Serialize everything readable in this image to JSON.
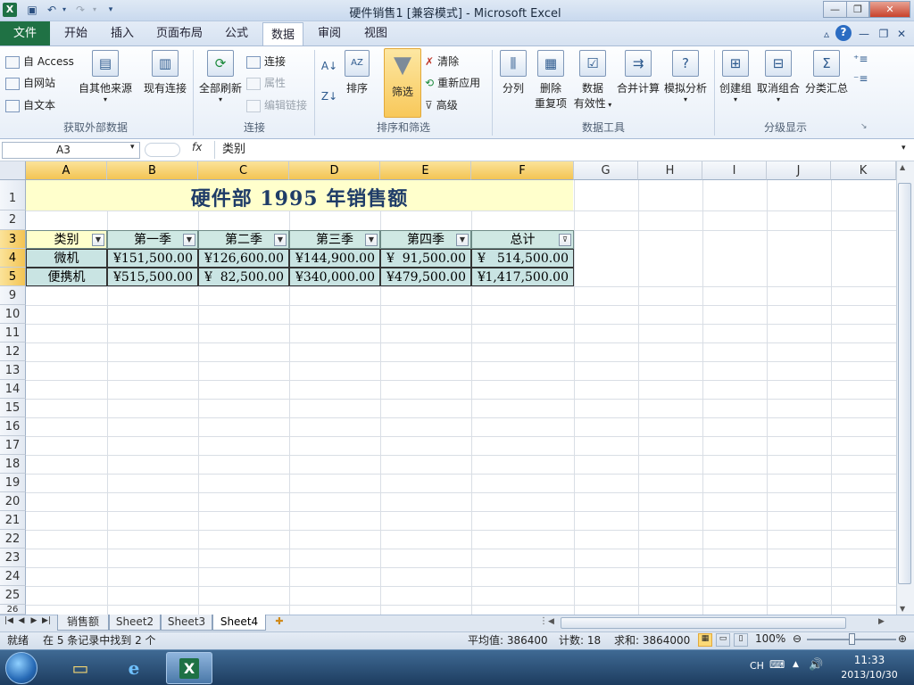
{
  "window": {
    "title": "硬件销售1 [兼容模式] - Microsoft Excel",
    "app_icon": "X",
    "controls": {
      "minimize": "—",
      "restore": "❐",
      "close": "✕"
    }
  },
  "quick_access": {
    "save_icon": "save-icon",
    "undo_icon": "undo-icon",
    "redo_icon": "redo-icon"
  },
  "ribbon": {
    "file_tab": "文件",
    "tabs": [
      "开始",
      "插入",
      "页面布局",
      "公式",
      "数据",
      "审阅",
      "视图"
    ],
    "active_tab": "数据",
    "groups": {
      "external": {
        "label": "获取外部数据",
        "access": "自 Access",
        "web": "自网站",
        "text": "自文本",
        "other": "自其他来源",
        "existing": "现有连接"
      },
      "connections": {
        "label": "连接",
        "refresh_all": "全部刷新",
        "connections": "连接",
        "properties": "属性",
        "edit_links": "编辑链接"
      },
      "sort_filter": {
        "label": "排序和筛选",
        "sort": "排序",
        "filter": "筛选",
        "clear": "清除",
        "reapply": "重新应用",
        "advanced": "高级"
      },
      "data_tools": {
        "label": "数据工具",
        "text_to_columns": "分列",
        "remove_dup_1": "删除",
        "remove_dup_2": "重复项",
        "validation_1": "数据",
        "validation_2": "有效性",
        "consolidate": "合并计算",
        "what_if": "模拟分析"
      },
      "outline": {
        "label": "分级显示",
        "group": "创建组",
        "ungroup": "取消组合",
        "subtotal": "分类汇总"
      }
    }
  },
  "formula_bar": {
    "name_box": "A3",
    "fx": "fx",
    "content": "类别"
  },
  "sheet": {
    "columns": [
      "A",
      "B",
      "C",
      "D",
      "E",
      "F",
      "G",
      "H",
      "I",
      "J",
      "K"
    ],
    "row_numbers": [
      "1",
      "2",
      "3",
      "4",
      "5",
      "9",
      "10",
      "11",
      "12",
      "13",
      "14",
      "15",
      "16",
      "17",
      "18",
      "19",
      "20",
      "21",
      "22",
      "23",
      "24",
      "25",
      "26"
    ],
    "banner": "硬件部 1995 年销售额",
    "headers": [
      "类别",
      "第一季",
      "第二季",
      "第三季",
      "第四季",
      "总计"
    ],
    "currency": "¥",
    "rows": [
      {
        "category": "微机",
        "values": [
          "151,500.00",
          "126,600.00",
          "144,900.00",
          "91,500.00",
          "514,500.00"
        ]
      },
      {
        "category": "便携机",
        "values": [
          "515,500.00",
          "82,500.00",
          "340,000.00",
          "479,500.00",
          "1,417,500.00"
        ]
      }
    ]
  },
  "sheet_tabs": [
    "销售额",
    "Sheet2",
    "Sheet3",
    "Sheet4"
  ],
  "active_sheet": "Sheet4",
  "status": {
    "ready": "就绪",
    "filter_msg": "在 5 条记录中找到 2 个",
    "average": "平均值: 386400",
    "count": "计数: 18",
    "sum": "求和: 3864000",
    "zoom": "100%",
    "zoom_fraction": 0.5
  },
  "taskbar": {
    "input_lang": "CH",
    "time": "11:33",
    "date": "2013/10/30"
  },
  "colors": {
    "file_tab": "#1f7144",
    "banner_fill": "#ffffcc",
    "table_fill": "#c9e4e3",
    "selected_header": "#f3c453"
  }
}
